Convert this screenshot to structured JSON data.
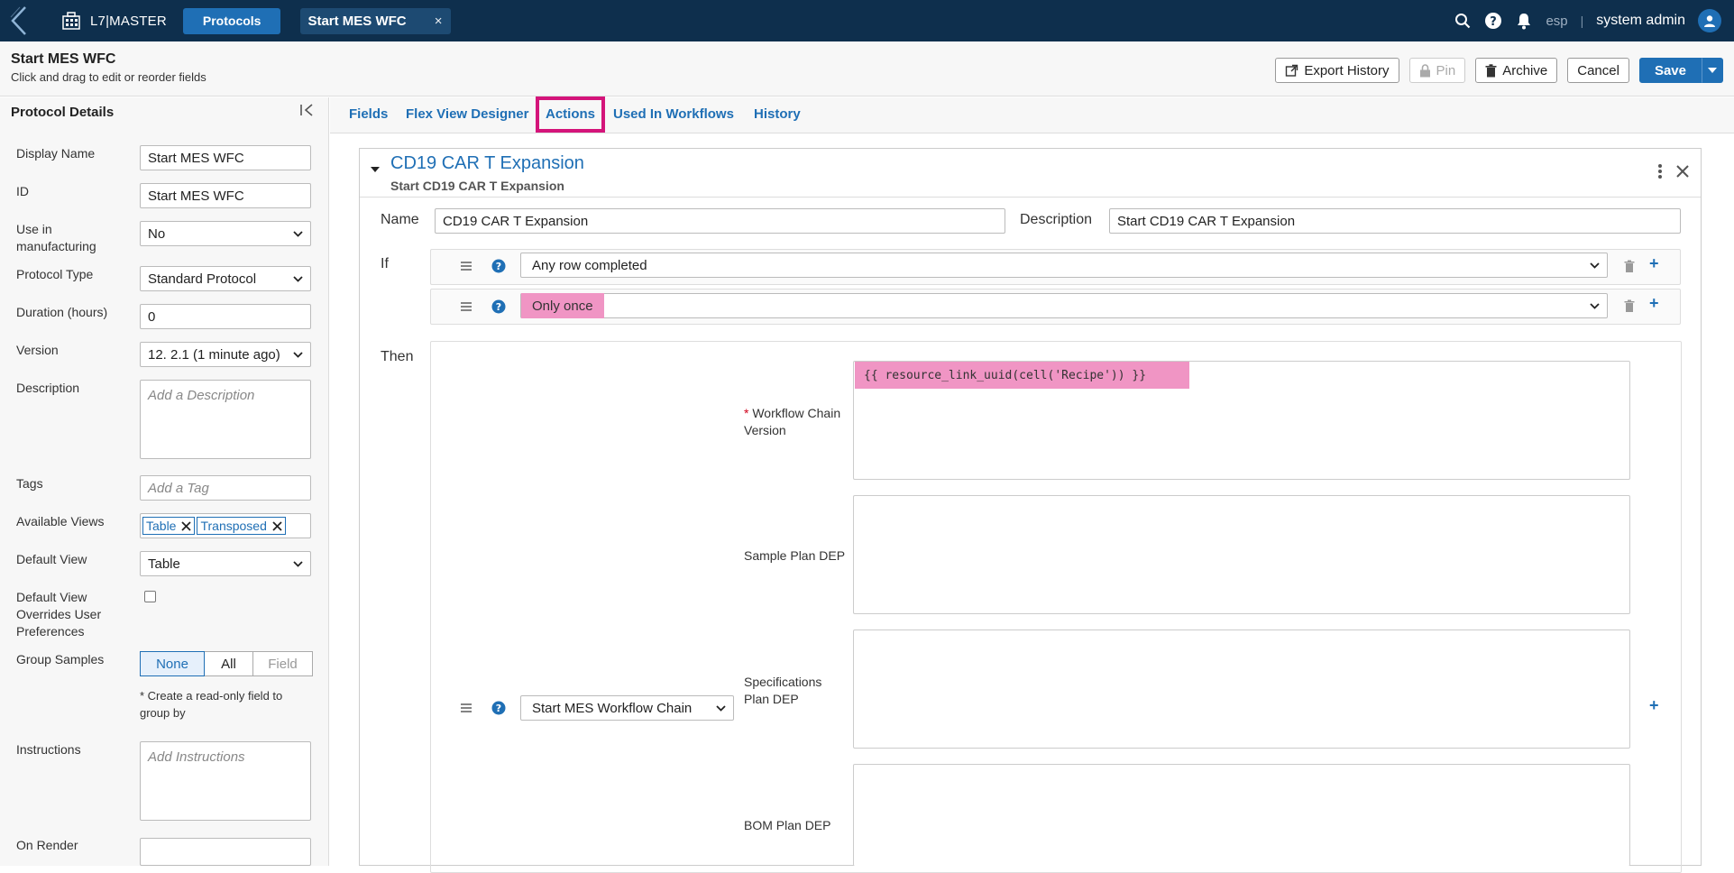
{
  "topnav": {
    "app_name": "L7|MASTER",
    "protocols_label": "Protocols",
    "open_tab_label": "Start MES WFC",
    "open_tab_close": "×",
    "lang": "esp",
    "divider": "|",
    "user_name": "system admin"
  },
  "header": {
    "title": "Start MES WFC",
    "subtitle": "Click and drag to edit or reorder fields",
    "export_history": "Export History",
    "pin": "Pin",
    "archive": "Archive",
    "cancel": "Cancel",
    "save": "Save"
  },
  "left_panel": {
    "title": "Protocol Details",
    "fields": {
      "display_name_label": "Display Name",
      "display_name_value": "Start MES WFC",
      "id_label": "ID",
      "id_value": "Start MES WFC",
      "use_in_mfg_label": "Use in manufacturing",
      "use_in_mfg_value": "No",
      "protocol_type_label": "Protocol Type",
      "protocol_type_value": "Standard Protocol",
      "duration_label": "Duration (hours)",
      "duration_value": "0",
      "version_label": "Version",
      "version_value": "12. 2.1 (1 minute ago)",
      "description_label": "Description",
      "description_placeholder": "Add a Description",
      "tags_label": "Tags",
      "tags_placeholder": "Add a Tag",
      "available_views_label": "Available Views",
      "available_views": [
        "Table",
        "Transposed"
      ],
      "default_view_label": "Default View",
      "default_view_value": "Table",
      "default_view_override_label": "Default View Overrides User Preferences",
      "group_samples_label": "Group Samples",
      "group_samples_options": [
        "None",
        "All",
        "Field"
      ],
      "group_note": "* Create a read-only field to group by",
      "instructions_label": "Instructions",
      "instructions_placeholder": "Add Instructions",
      "on_render_label": "On Render"
    }
  },
  "tabs": [
    "Fields",
    "Flex View Designer",
    "Actions",
    "Used In Workflows",
    "History"
  ],
  "action": {
    "title": "CD19 CAR T Expansion",
    "subtitle": "Start CD19 CAR T Expansion",
    "name_label": "Name",
    "name_value": "CD19 CAR T Expansion",
    "description_label": "Description",
    "description_value": "Start CD19 CAR T Expansion",
    "if_label": "If",
    "conditions": [
      "Any row completed",
      "Only once"
    ],
    "then_label": "Then",
    "then_action": "Start MES Workflow Chain",
    "params": {
      "req_mark": "*",
      "wfc_version_label": "Workflow Chain Version",
      "wfc_version_value": "{{ resource_link_uuid(cell('Recipe')) }}",
      "sample_plan_label": "Sample Plan DEP",
      "spec_plan_label": "Specifications Plan DEP",
      "bom_plan_label": "BOM Plan DEP"
    }
  },
  "colors": {
    "nav_bg": "#0e2f4d",
    "accent": "#1f6fb5",
    "highlight": "#f095c4",
    "active_tab_box": "#d4147a"
  }
}
